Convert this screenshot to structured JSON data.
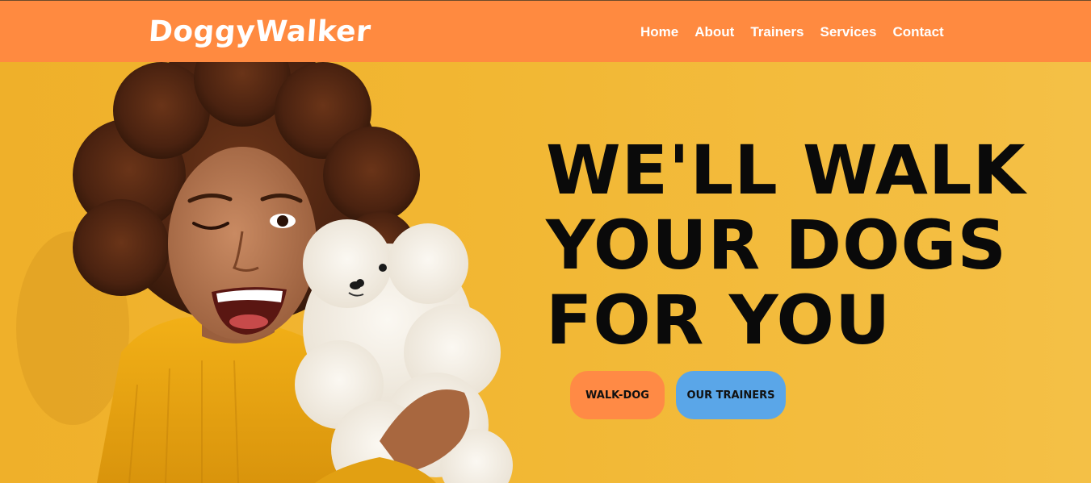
{
  "brand": {
    "logo_text": "DoggyWalker"
  },
  "nav": {
    "items": [
      {
        "label": "Home"
      },
      {
        "label": "About"
      },
      {
        "label": "Trainers"
      },
      {
        "label": "Services"
      },
      {
        "label": "Contact"
      }
    ]
  },
  "hero": {
    "headline_lines": [
      "WE'LL WALK",
      "YOUR DOGS",
      "FOR YOU"
    ],
    "primary_button": "WALK-DOG",
    "secondary_button": "OUR TRAINERS"
  },
  "colors": {
    "navbar": "#ff8a40",
    "hero_background": "#f2b731",
    "primary_button": "#ff8a45",
    "secondary_button": "#5aa6e8"
  }
}
